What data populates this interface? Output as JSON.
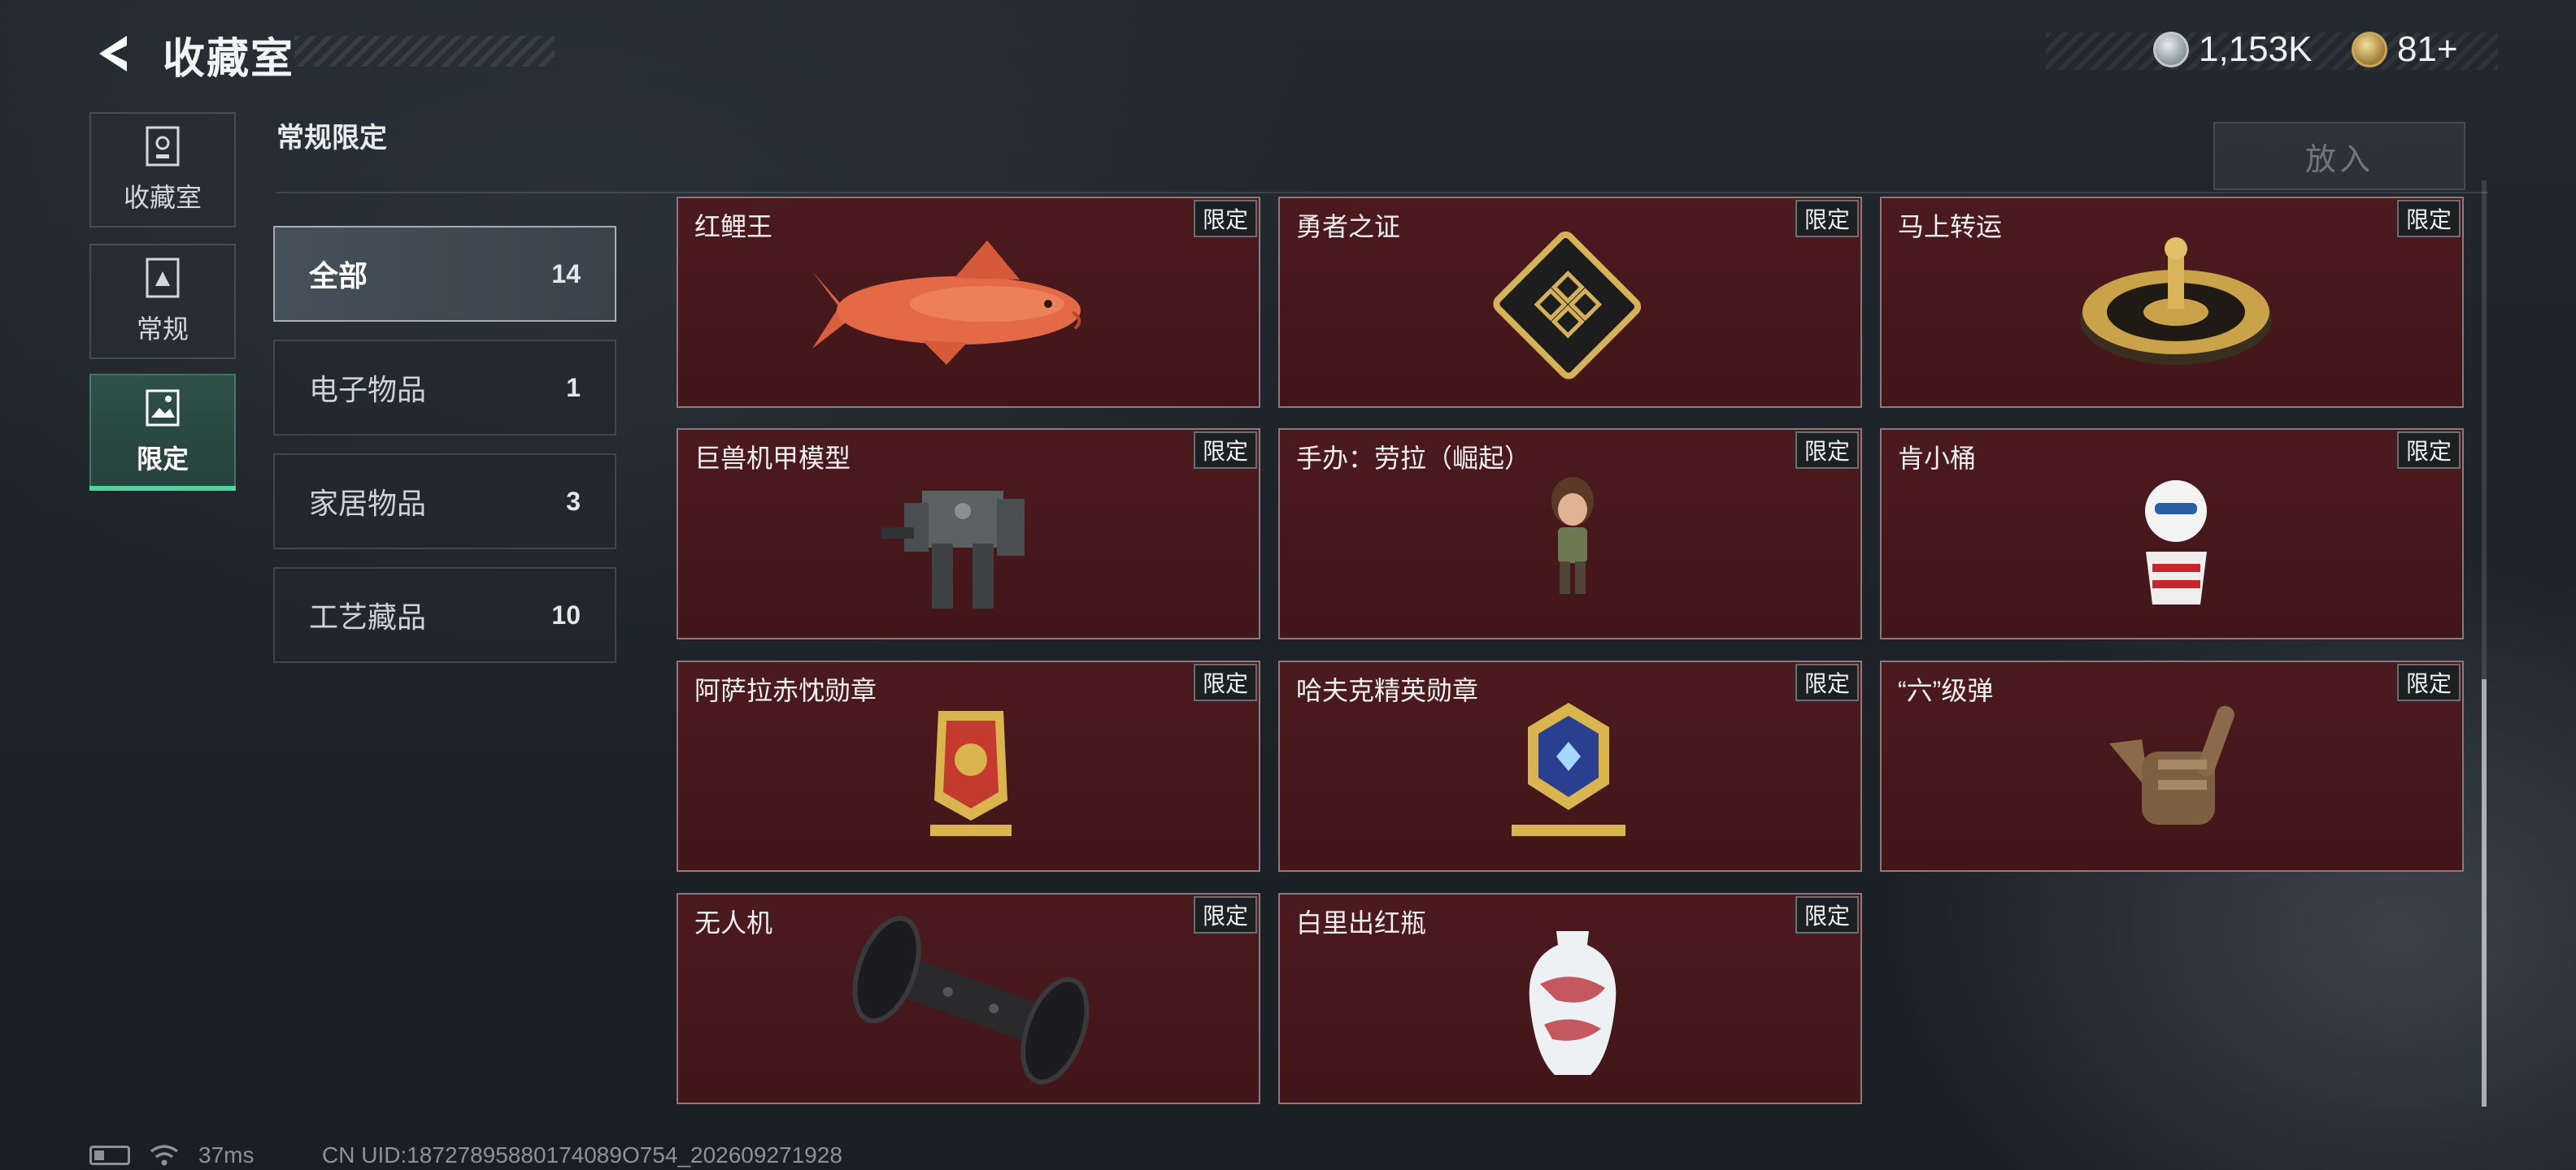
{
  "header": {
    "title": "收藏室",
    "back_icon": "back-arrow-icon",
    "currency": [
      {
        "icon": "silver-coin-icon",
        "value": "1,153K",
        "color": "#b9c1c8"
      },
      {
        "icon": "gold-token-icon",
        "value": "81+",
        "color": "#c9a659"
      }
    ]
  },
  "nav": [
    {
      "label": "收藏室",
      "icon": "trophy-icon",
      "active": false
    },
    {
      "label": "常规",
      "icon": "book-icon",
      "active": false
    },
    {
      "label": "限定",
      "icon": "image-frame-icon",
      "active": true
    }
  ],
  "section": {
    "title": "常规限定",
    "put_in_label": "放入"
  },
  "categories": [
    {
      "name": "全部",
      "count": "14",
      "active": true
    },
    {
      "name": "电子物品",
      "count": "1",
      "active": false
    },
    {
      "name": "家居物品",
      "count": "3",
      "active": false
    },
    {
      "name": "工艺藏品",
      "count": "10",
      "active": false
    }
  ],
  "items": [
    {
      "name": "红鲤王",
      "tag": "限定",
      "icon": "red-carp-icon"
    },
    {
      "name": "勇者之证",
      "tag": "限定",
      "icon": "gold-card-icon"
    },
    {
      "name": "马上转运",
      "tag": "限定",
      "icon": "fortune-wheel-icon"
    },
    {
      "name": "巨兽机甲模型",
      "tag": "限定",
      "icon": "mech-model-icon"
    },
    {
      "name": "手办：劳拉（崛起）",
      "tag": "限定",
      "icon": "figurine-icon"
    },
    {
      "name": "肯小桶",
      "tag": "限定",
      "icon": "bucket-figure-icon"
    },
    {
      "name": "阿萨拉赤忱勋章",
      "tag": "限定",
      "icon": "red-medal-icon"
    },
    {
      "name": "哈夫克精英勋章",
      "tag": "限定",
      "icon": "blue-medal-icon"
    },
    {
      "name": "“六”级弹",
      "tag": "限定",
      "icon": "hand-sculpture-icon"
    },
    {
      "name": "无人机",
      "tag": "限定",
      "icon": "drone-icon"
    },
    {
      "name": "白里出红瓶",
      "tag": "限定",
      "icon": "vase-icon"
    }
  ],
  "status": {
    "ping": "37ms",
    "uid": "CN UID:18727895880174089O754_202609271928"
  }
}
